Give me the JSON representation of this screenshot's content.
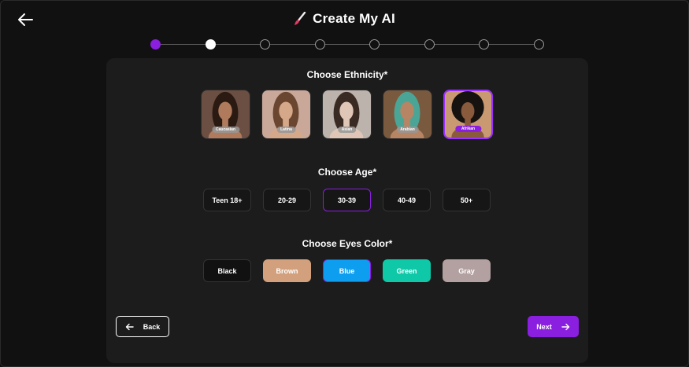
{
  "header": {
    "title": "Create My AI"
  },
  "stepper": {
    "total": 8,
    "completed": 1,
    "current": 2
  },
  "ethnicity": {
    "title": "Choose Ethnicity*",
    "selected": "Afrikan",
    "options": [
      {
        "label": "Caucasian",
        "skin": "#b07a5c",
        "hair": "#2a1a12",
        "bg": "#6b4f43"
      },
      {
        "label": "Latina",
        "skin": "#d6a88a",
        "hair": "#6a4530",
        "bg": "#c9a89a"
      },
      {
        "label": "Asian",
        "skin": "#e0c6b6",
        "hair": "#3a2a24",
        "bg": "#bdb3ad"
      },
      {
        "label": "Arabian",
        "skin": "#b78563",
        "hair": "#4aa596",
        "bg": "#7a5a3f"
      },
      {
        "label": "Afrikan",
        "skin": "#8a5a3c",
        "hair": "#161210",
        "bg": "#c99a72"
      }
    ]
  },
  "age": {
    "title": "Choose Age*",
    "selected": "30-39",
    "options": [
      "Teen 18+",
      "20-29",
      "30-39",
      "40-49",
      "50+"
    ]
  },
  "eyes": {
    "title": "Choose Eyes Color*",
    "selected": "Blue",
    "options": [
      {
        "label": "Black",
        "color": "#111111"
      },
      {
        "label": "Brown",
        "color": "#d2a07c"
      },
      {
        "label": "Blue",
        "color": "#0e9ef0"
      },
      {
        "label": "Green",
        "color": "#0ec8a8"
      },
      {
        "label": "Gray",
        "color": "#b3a0a0"
      }
    ]
  },
  "nav": {
    "back_label": "Back",
    "next_label": "Next"
  },
  "colors": {
    "accent": "#8b1fe0",
    "card": "#1c1c1c",
    "background": "#111111"
  }
}
